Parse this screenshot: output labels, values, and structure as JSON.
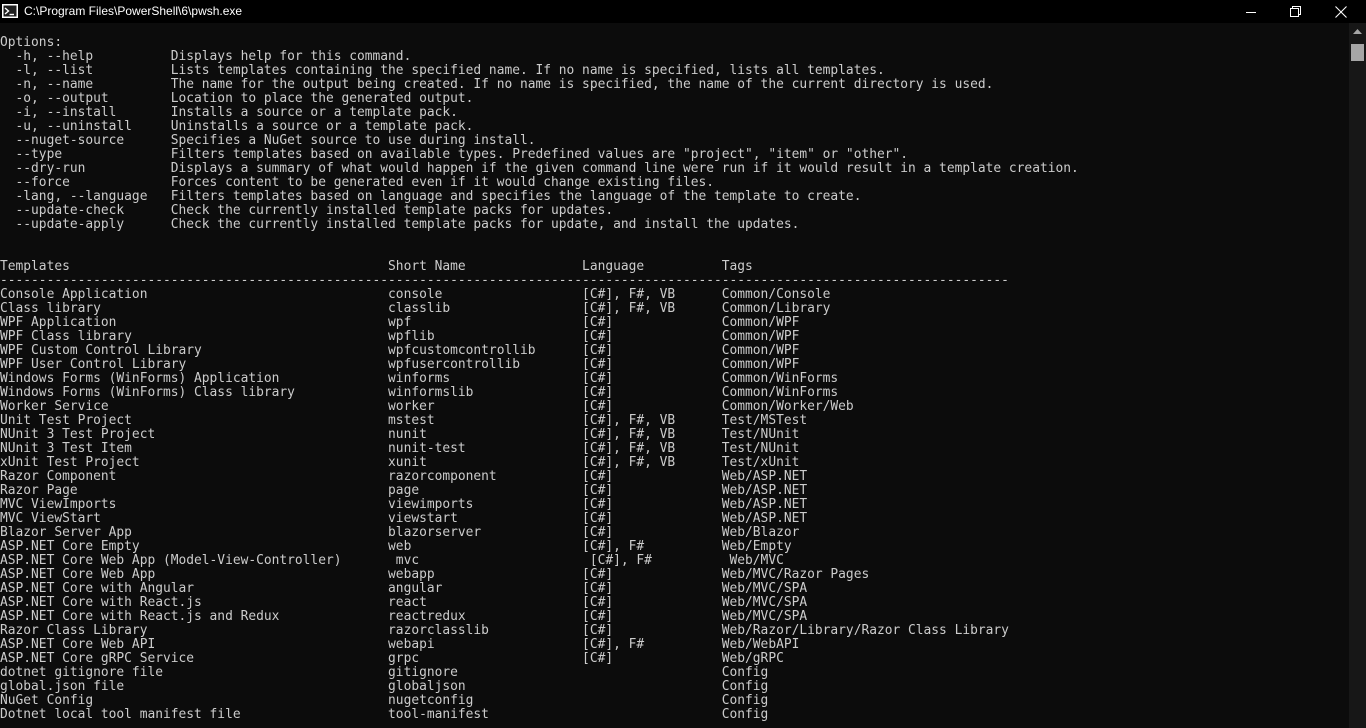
{
  "window": {
    "title": "C:\\Program Files\\PowerShell\\6\\pwsh.exe",
    "icons": {
      "app": "powershell-icon",
      "minimize": "minimize-icon",
      "maximize": "maximize-icon",
      "close": "close-icon",
      "scroll_up": "arrow-up-icon"
    }
  },
  "colors": {
    "background": "#0c0c0c",
    "foreground": "#cccccc",
    "titlebar": "#000000"
  },
  "console": {
    "lines": [
      "Options:",
      "  -h, --help          Displays help for this command.",
      "  -l, --list          Lists templates containing the specified name. If no name is specified, lists all templates.",
      "  -n, --name          The name for the output being created. If no name is specified, the name of the current directory is used.",
      "  -o, --output        Location to place the generated output.",
      "  -i, --install       Installs a source or a template pack.",
      "  -u, --uninstall     Uninstalls a source or a template pack.",
      "  --nuget-source      Specifies a NuGet source to use during install.",
      "  --type              Filters templates based on available types. Predefined values are \"project\", \"item\" or \"other\".",
      "  --dry-run           Displays a summary of what would happen if the given command line were run if it would result in a template creation.",
      "  --force             Forces content to be generated even if it would change existing files.",
      "  -lang, --language   Filters templates based on language and specifies the language of the template to create.",
      "  --update-check      Check the currently installed template packs for updates.",
      "  --update-apply      Check the currently installed template packs for update, and install the updates.",
      "",
      "",
      "Templates                                         Short Name               Language          Tags",
      "----------------------------------------------------------------------------------------------------------------------------------",
      "Console Application                               console                  [C#], F#, VB      Common/Console",
      "Class library                                     classlib                 [C#], F#, VB      Common/Library",
      "WPF Application                                   wpf                      [C#]              Common/WPF",
      "WPF Class library                                 wpflib                   [C#]              Common/WPF",
      "WPF Custom Control Library                        wpfcustomcontrollib      [C#]              Common/WPF",
      "WPF User Control Library                          wpfusercontrollib        [C#]              Common/WPF",
      "Windows Forms (WinForms) Application              winforms                 [C#]              Common/WinForms",
      "Windows Forms (WinForms) Class library            winformslib              [C#]              Common/WinForms",
      "Worker Service                                    worker                   [C#]              Common/Worker/Web",
      "Unit Test Project                                 mstest                   [C#], F#, VB      Test/MSTest",
      "NUnit 3 Test Project                              nunit                    [C#], F#, VB      Test/NUnit",
      "NUnit 3 Test Item                                 nunit-test               [C#], F#, VB      Test/NUnit",
      "xUnit Test Project                                xunit                    [C#], F#, VB      Test/xUnit",
      "Razor Component                                   razorcomponent           [C#]              Web/ASP.NET",
      "Razor Page                                        page                     [C#]              Web/ASP.NET",
      "MVC ViewImports                                   viewimports              [C#]              Web/ASP.NET",
      "MVC ViewStart                                     viewstart                [C#]              Web/ASP.NET",
      "Blazor Server App                                 blazorserver             [C#]              Web/Blazor",
      "ASP.NET Core Empty                                web                      [C#], F#          Web/Empty",
      "ASP.NET Core Web App (Model-View-Controller)       mvc                      [C#], F#          Web/MVC",
      "ASP.NET Core Web App                              webapp                   [C#]              Web/MVC/Razor Pages",
      "ASP.NET Core with Angular                         angular                  [C#]              Web/MVC/SPA",
      "ASP.NET Core with React.js                        react                    [C#]              Web/MVC/SPA",
      "ASP.NET Core with React.js and Redux              reactredux               [C#]              Web/MVC/SPA",
      "Razor Class Library                               razorclasslib            [C#]              Web/Razor/Library/Razor Class Library",
      "ASP.NET Core Web API                              webapi                   [C#], F#          Web/WebAPI",
      "ASP.NET Core gRPC Service                         grpc                     [C#]              Web/gRPC",
      "dotnet gitignore file                             gitignore                                  Config",
      "global.json file                                  globaljson                                 Config",
      "NuGet Config                                      nugetconfig                                Config",
      "Dotnet local tool manifest file                   tool-manifest                              Config"
    ]
  }
}
